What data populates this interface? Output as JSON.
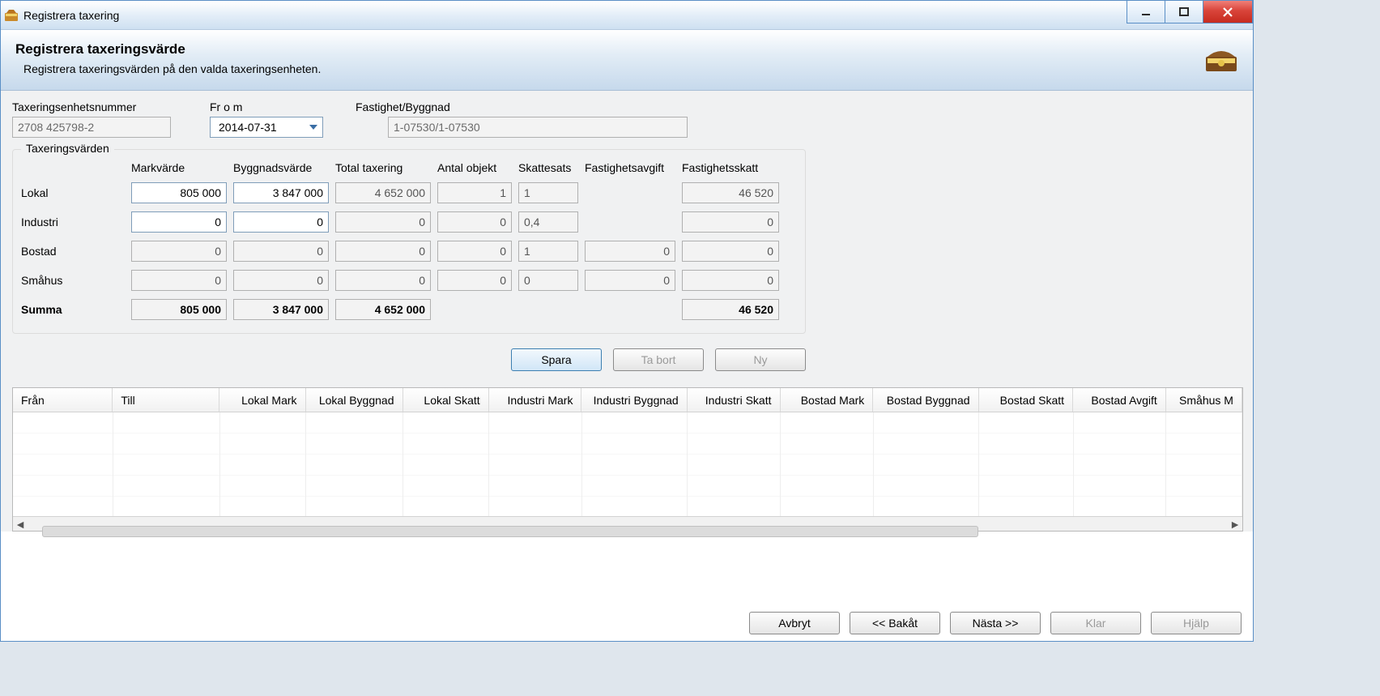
{
  "window": {
    "title": "Registrera taxering",
    "controls": {
      "minimize": "minimize",
      "maximize": "maximize",
      "close": "close"
    }
  },
  "header": {
    "title": "Registrera taxeringsvärde",
    "subtitle": "Registrera taxeringsvärden på den valda taxeringsenheten."
  },
  "fields": {
    "tax_unit_label": "Taxeringsenhetsnummer",
    "tax_unit_value": "2708 425798-2",
    "from_label": "Fr o m",
    "from_value": "2014-07-31",
    "property_label": "Fastighet/Byggnad",
    "property_value": "1-07530/1-07530"
  },
  "group": {
    "legend": "Taxeringsvärden",
    "col_spacer": "",
    "col_mark": "Markvärde",
    "col_byggnad": "Byggnadsvärde",
    "col_total": "Total taxering",
    "col_antal": "Antal objekt",
    "col_sats": "Skattesats",
    "col_avgift": "Fastighetsavgift",
    "col_skatt": "Fastighetsskatt",
    "rows": {
      "lokal": {
        "label": "Lokal",
        "mark": "805 000",
        "byggnad": "3 847 000",
        "total": "4 652 000",
        "antal": "1",
        "sats": "1",
        "avgift": "",
        "skatt": "46 520"
      },
      "industri": {
        "label": "Industri",
        "mark": "0",
        "byggnad": "0",
        "total": "0",
        "antal": "0",
        "sats": "0,4",
        "avgift": "",
        "skatt": "0"
      },
      "bostad": {
        "label": "Bostad",
        "mark": "0",
        "byggnad": "0",
        "total": "0",
        "antal": "0",
        "sats": "1",
        "avgift": "0",
        "skatt": "0"
      },
      "smahus": {
        "label": "Småhus",
        "mark": "0",
        "byggnad": "0",
        "total": "0",
        "antal": "0",
        "sats": "0",
        "avgift": "0",
        "skatt": "0"
      },
      "summa": {
        "label": "Summa",
        "mark": "805 000",
        "byggnad": "3 847 000",
        "total": "4 652 000",
        "antal": "",
        "sats": "",
        "avgift": "",
        "skatt": "46 520"
      }
    }
  },
  "actions": {
    "save": "Spara",
    "delete": "Ta bort",
    "new": "Ny"
  },
  "table": {
    "headers": [
      "Från",
      "Till",
      "Lokal Mark",
      "Lokal Byggnad",
      "Lokal Skatt",
      "Industri Mark",
      "Industri Byggnad",
      "Industri Skatt",
      "Bostad Mark",
      "Bostad Byggnad",
      "Bostad Skatt",
      "Bostad Avgift",
      "Småhus M"
    ]
  },
  "footer": {
    "cancel": "Avbryt",
    "back": "<< Bakåt",
    "next": "Nästa >>",
    "done": "Klar",
    "help": "Hjälp"
  }
}
